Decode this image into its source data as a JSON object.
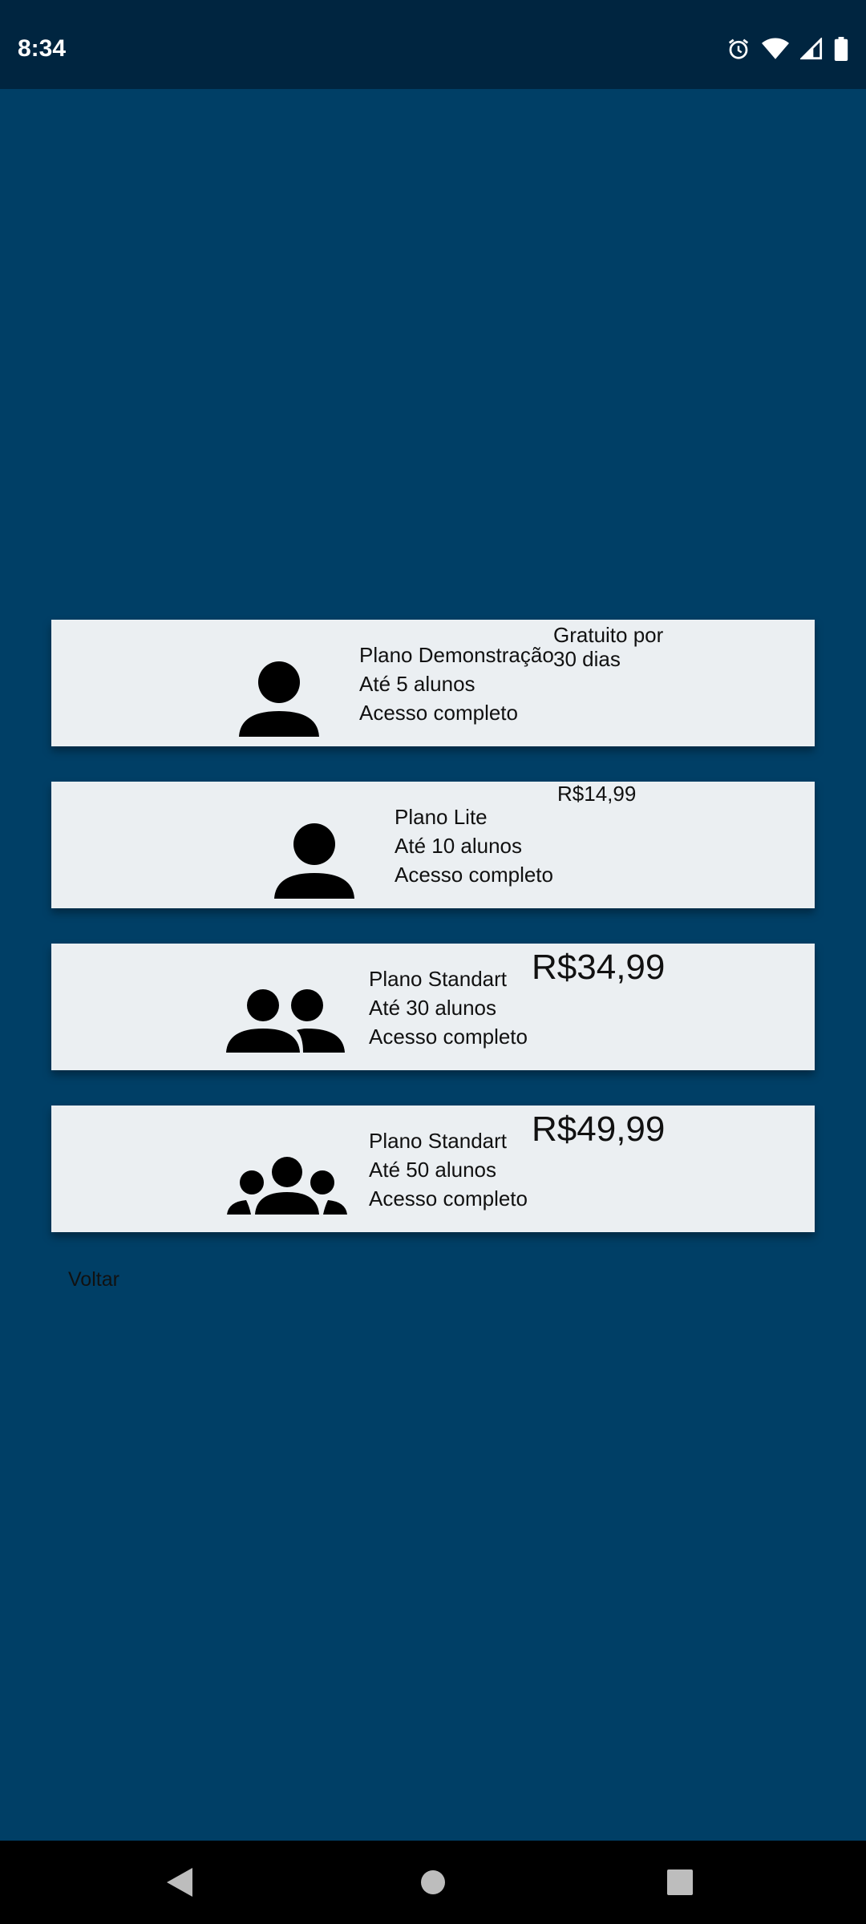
{
  "status_bar": {
    "time": "8:34",
    "icons": [
      "alarm-icon",
      "wifi-icon",
      "signal-icon",
      "battery-icon"
    ]
  },
  "plans": [
    {
      "name": "Plano Demonstração",
      "students": "Até 5 alunos",
      "access": "Acesso completo",
      "price_line1": "Gratuito por",
      "price_line2": "30 dias",
      "icon": "person-icon"
    },
    {
      "name": "Plano Lite",
      "students": "Até 10 alunos",
      "access": "Acesso completo",
      "price": "R$14,99",
      "icon": "person-icon"
    },
    {
      "name": "Plano Standart",
      "students": "Até 30 alunos",
      "access": "Acesso completo",
      "price": "R$34,99",
      "icon": "people-icon"
    },
    {
      "name": "Plano Standart",
      "students": "Até 50 alunos",
      "access": "Acesso completo",
      "price": "R$49,99",
      "icon": "groups-icon"
    }
  ],
  "back_label": "Voltar",
  "colors": {
    "background": "#003f66",
    "status_bar": "#002540",
    "card": "#ebeff2",
    "nav_bar": "#000000"
  }
}
